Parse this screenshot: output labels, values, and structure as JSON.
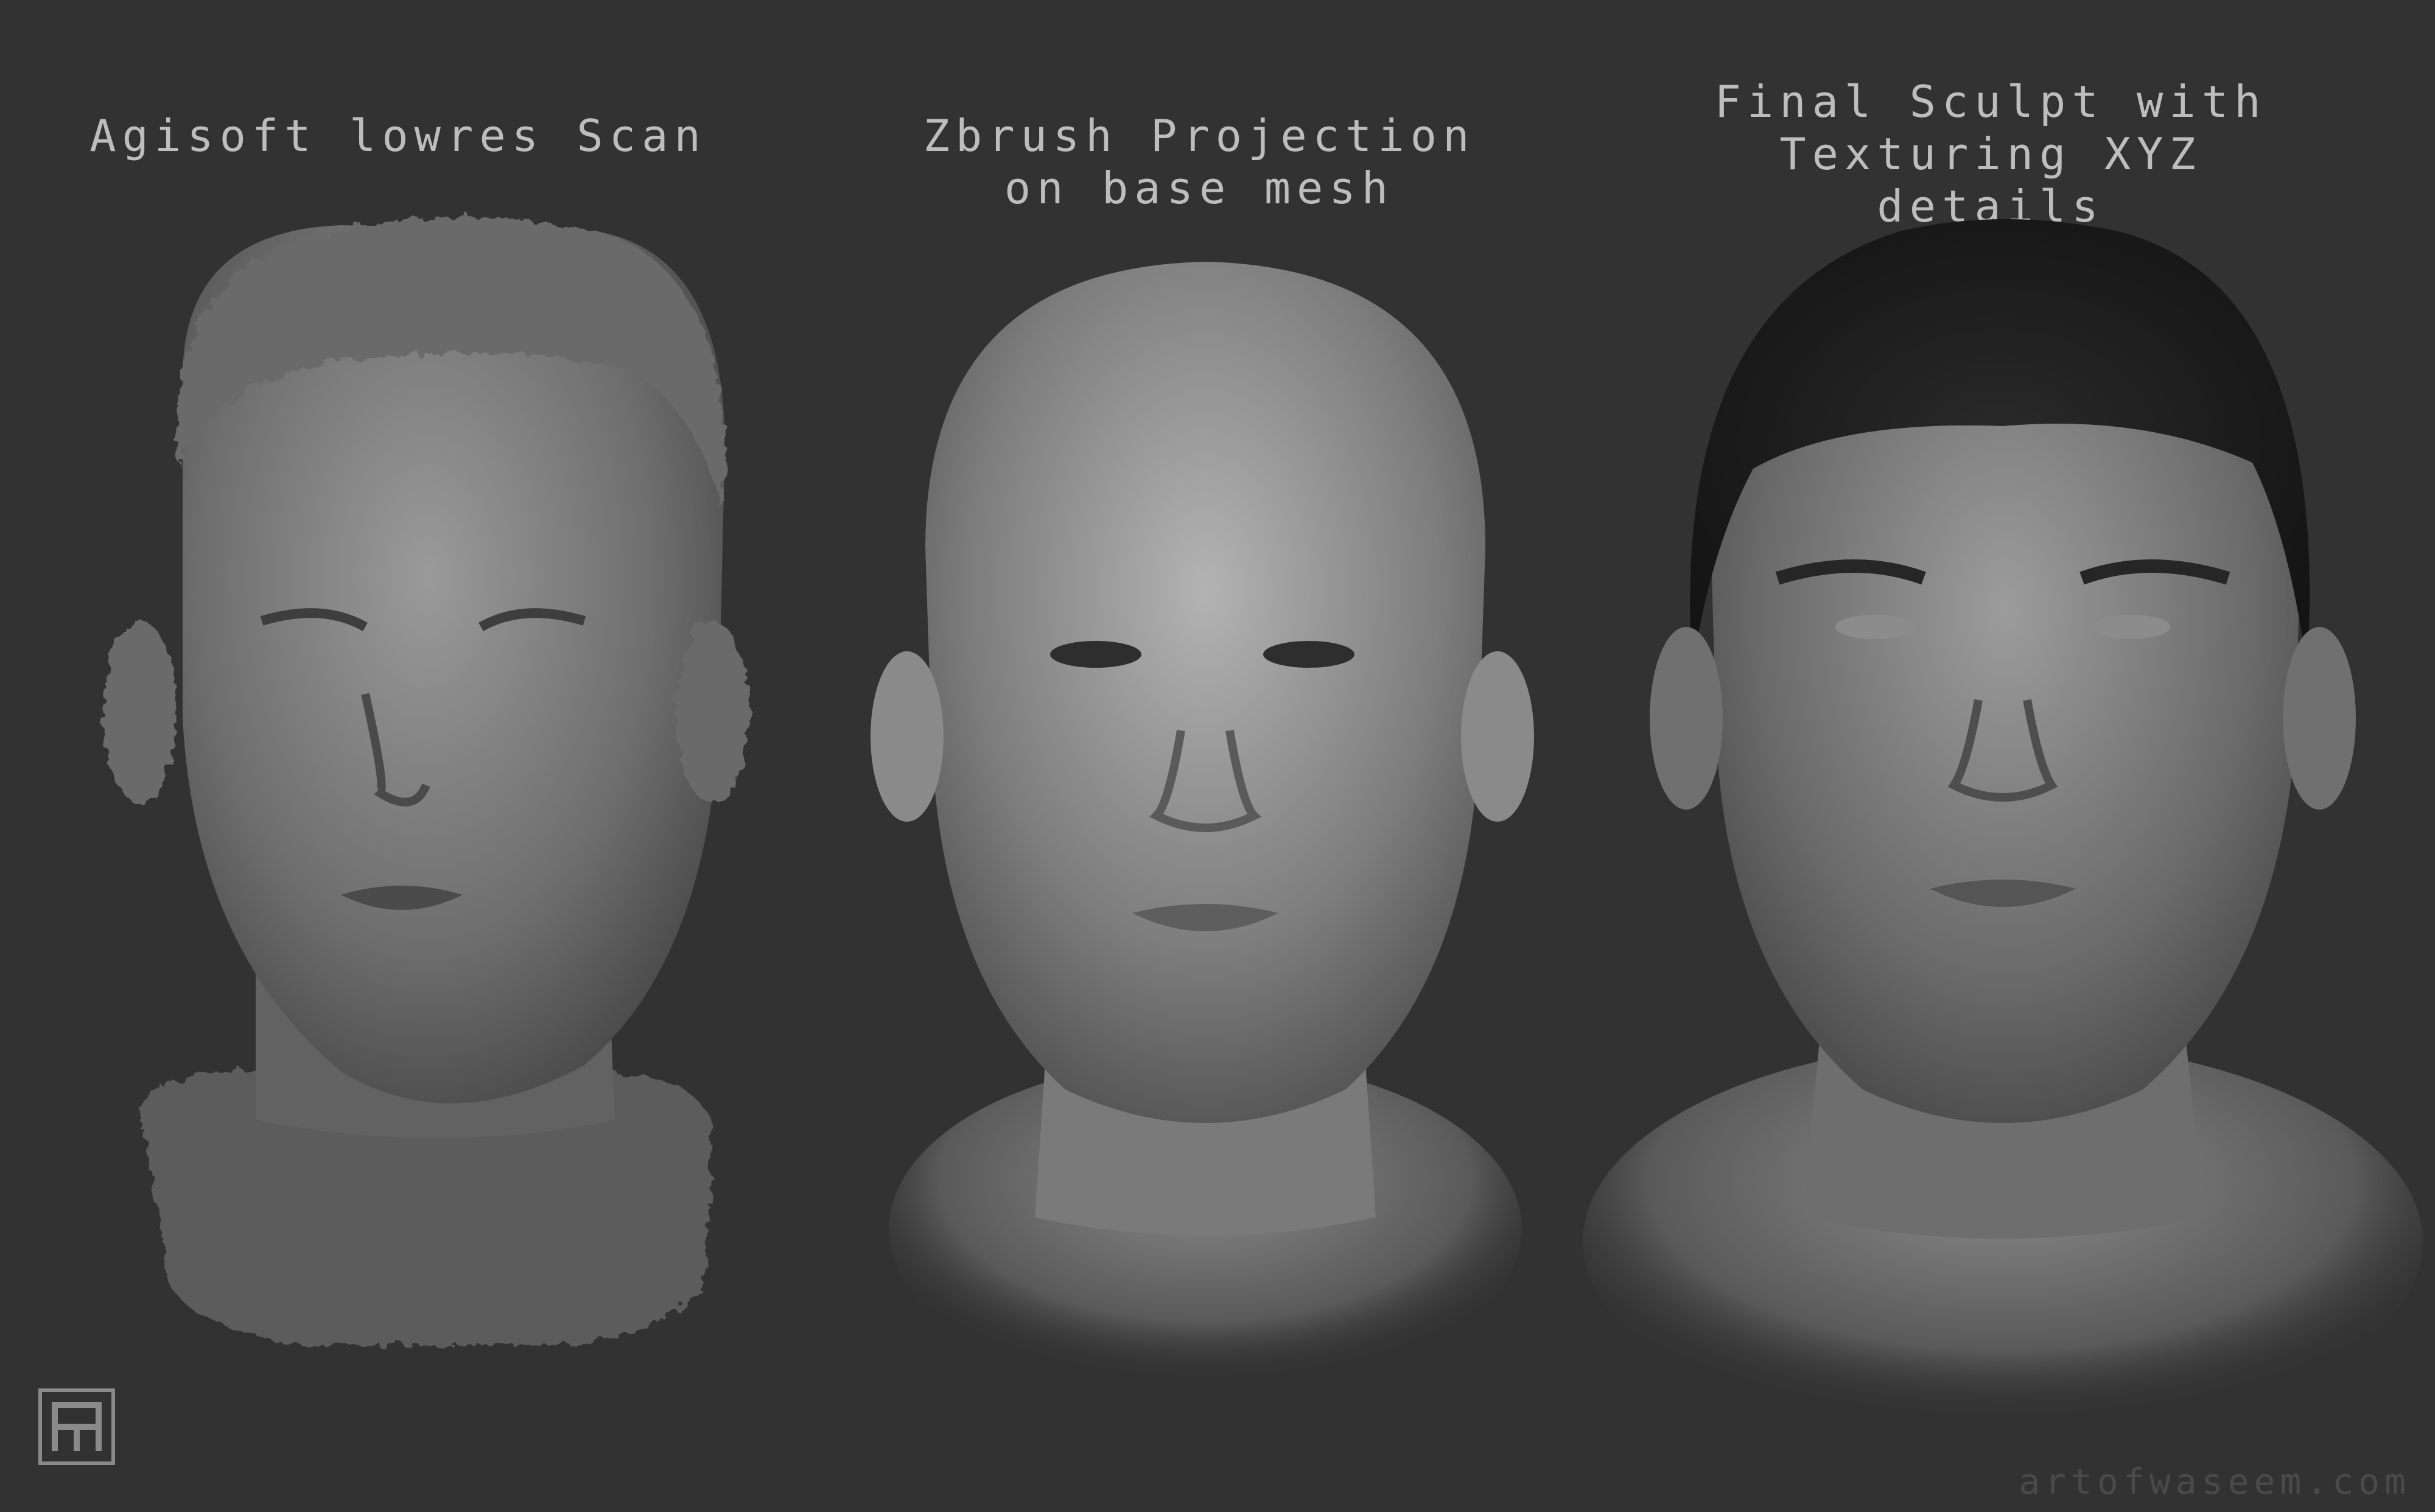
{
  "panels": [
    {
      "id": "scan",
      "caption_lines": [
        "Agisoft lowres Scan"
      ]
    },
    {
      "id": "projection",
      "caption_lines": [
        "Zbrush Projection",
        "on base mesh"
      ]
    },
    {
      "id": "final",
      "caption_lines": [
        "Final Sculpt with",
        "Texturing XYZ details"
      ]
    }
  ],
  "footer": {
    "watermark": "artofwaseem.com"
  },
  "colors": {
    "background": "#323232",
    "caption": "#bdbdbd",
    "clay_light": "#a9a9a9",
    "clay_dark": "#4d4d4d",
    "hair": "#1c1c1c"
  }
}
